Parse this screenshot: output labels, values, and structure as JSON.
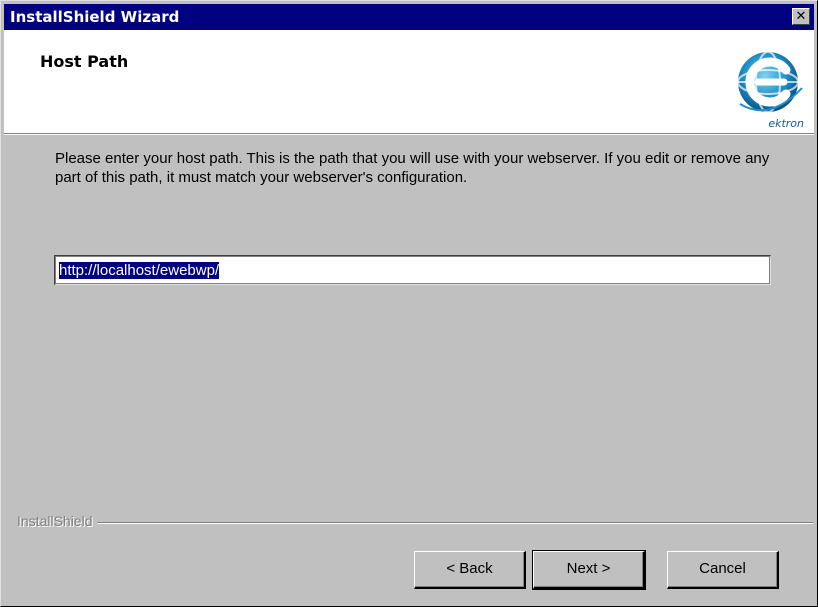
{
  "window": {
    "title": "InstallShield Wizard",
    "close_glyph": "✕"
  },
  "header": {
    "heading": "Host Path",
    "logo_text": "ektron",
    "logo_icon": "ektron-logo-icon"
  },
  "body": {
    "description": "Please enter your host path. This is the path that you will use with your webserver. If you edit or remove any part of this path, it must match your webserver's configuration.",
    "host_path_value": "http://localhost/ewebwp/"
  },
  "footer": {
    "brand_label": "InstallShield",
    "back_label": "< Back",
    "next_label": "Next >",
    "cancel_label": "Cancel"
  },
  "colors": {
    "titlebar": "#000080",
    "dialog": "#c0c0c0",
    "selection": "#000080"
  }
}
